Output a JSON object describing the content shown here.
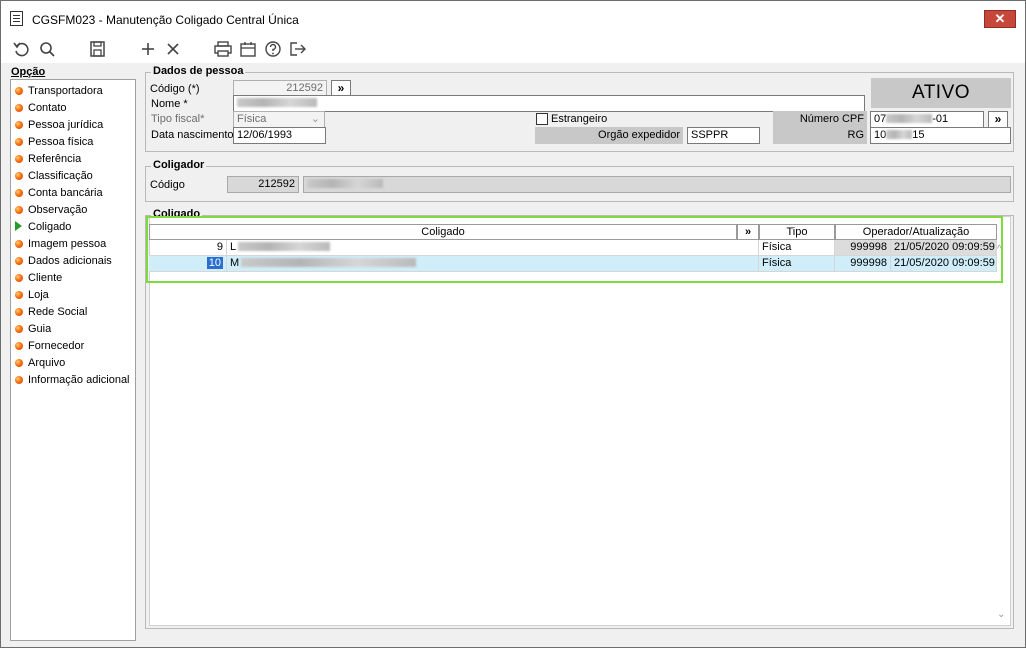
{
  "window": {
    "title": "CGSFM023 - Manutenção Coligado Central Única",
    "close_label": "✕"
  },
  "toolbar": {
    "icons": [
      "undo-icon",
      "search-icon",
      "save-icon",
      "add-icon",
      "delete-icon",
      "print-icon",
      "calendar-icon",
      "help-icon",
      "exit-icon"
    ]
  },
  "sidebar": {
    "title": "Opção",
    "items": [
      {
        "label": "Transportadora"
      },
      {
        "label": "Contato"
      },
      {
        "label": "Pessoa jurídica"
      },
      {
        "label": "Pessoa física"
      },
      {
        "label": "Referência"
      },
      {
        "label": "Classificação"
      },
      {
        "label": "Conta bancária"
      },
      {
        "label": "Observação"
      },
      {
        "label": "Coligado",
        "active": true
      },
      {
        "label": "Imagem pessoa"
      },
      {
        "label": "Dados adicionais"
      },
      {
        "label": "Cliente"
      },
      {
        "label": "Loja"
      },
      {
        "label": "Rede Social"
      },
      {
        "label": "Guia"
      },
      {
        "label": "Fornecedor"
      },
      {
        "label": "Arquivo"
      },
      {
        "label": "Informação adicional"
      }
    ]
  },
  "dados_pessoa": {
    "legend": "Dados de pessoa",
    "codigo_label": "Código (*)",
    "codigo_value": "212592",
    "more_button": "»",
    "nome_label": "Nome *",
    "tipo_fiscal_label": "Tipo fiscal*",
    "tipo_fiscal_value": "Física",
    "estrangeiro_label": "Estrangeiro",
    "data_nascimento_label": "Data nascimento",
    "data_nascimento_value": "12/06/1993",
    "orgao_expedidor_label": "Orgão expedidor",
    "orgao_expedidor_value": "SSPPR",
    "status": "ATIVO",
    "cpf_label": "Número CPF",
    "cpf_prefix": "07",
    "cpf_suffix": "-01",
    "rg_label": "RG",
    "rg_prefix": "10",
    "rg_suffix": "15"
  },
  "coligador": {
    "legend": "Coligador",
    "codigo_label": "Código",
    "codigo_value": "212592"
  },
  "coligado": {
    "legend": "Coligado",
    "columns": {
      "coligado": "Coligado",
      "more": "»",
      "tipo": "Tipo",
      "operador": "Operador/Atualização"
    },
    "rows": [
      {
        "id": "9",
        "name_initial": "L",
        "tipo": "Física",
        "operador": "999998",
        "atualizacao": "21/05/2020 09:09:59"
      },
      {
        "id": "10",
        "name_initial": "M",
        "tipo": "Física",
        "operador": "999998",
        "atualizacao": "21/05/2020 09:09:59",
        "selected": true
      }
    ]
  }
}
